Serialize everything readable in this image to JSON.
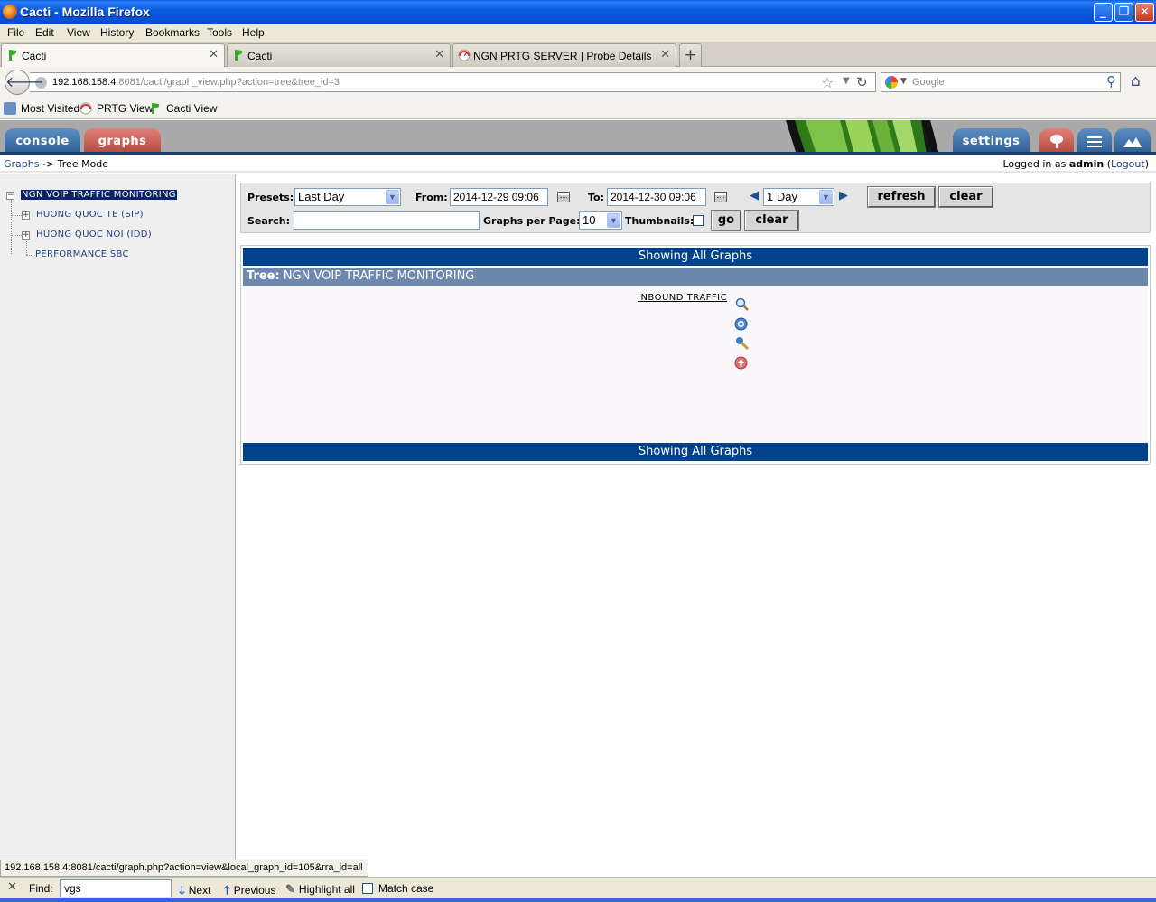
{
  "window": {
    "title": "Cacti - Mozilla Firefox",
    "controls": {
      "minimize": "_",
      "maximize": "❐",
      "close": "✕"
    }
  },
  "menu": [
    "File",
    "Edit",
    "View",
    "History",
    "Bookmarks",
    "Tools",
    "Help"
  ],
  "tabs": [
    {
      "label": "Cacti",
      "active": true
    },
    {
      "label": "Cacti",
      "active": false
    },
    {
      "label": "NGN PRTG SERVER | Probe Details | PRT...",
      "active": false
    }
  ],
  "newtab_label": "+",
  "address": {
    "host": "192.168.158.4",
    "rest": ":8081/cacti/graph_view.php?action=tree&tree_id=3"
  },
  "search": {
    "placeholder": "Google"
  },
  "bookmarks": [
    "Most Visited",
    "PRTG View",
    "Cacti View"
  ],
  "cacti_tabs": {
    "console": "console",
    "graphs": "graphs",
    "settings": "settings"
  },
  "breadcrumb": {
    "graphs": "Graphs",
    "sep": " -> ",
    "mode": "Tree Mode"
  },
  "login": {
    "prefix": "Logged in as ",
    "user": "admin",
    "open": " (",
    "logout": "Logout",
    "close": ")"
  },
  "tree": {
    "root": "NGN VOIP TRAFFIC MONITORING",
    "children": [
      "HUONG QUOC TE (SIP)",
      "HUONG QUOC NOI (IDD)",
      "PERFORMANCE SBC"
    ]
  },
  "filter": {
    "presets_label": "Presets:",
    "presets_value": "Last Day",
    "from_label": "From:",
    "from_value": "2014-12-29 09:06",
    "to_label": "To:",
    "to_value": "2014-12-30 09:06",
    "timespan_value": "1 Day",
    "refresh_label": "refresh",
    "clear_label": "clear",
    "search_label": "Search:",
    "search_value": "",
    "graphs_per_page_label": "Graphs per Page:",
    "graphs_per_page_value": "10",
    "thumbnails_label": "Thumbnails:",
    "go_label": "go",
    "clear2_label": "clear"
  },
  "panel": {
    "header": "Showing All Graphs",
    "tree_prefix": "Tree:",
    "tree_name": "NGN VOIP TRAFFIC MONITORING",
    "graph_title": "INBOUND TRAFFIC",
    "footer": "Showing All Graphs",
    "icons": [
      "zoom-icon",
      "info-icon",
      "properties-icon",
      "export-icon"
    ]
  },
  "statusbar": "192.168.158.4:8081/cacti/graph.php?action=view&local_graph_id=105&rra_id=all",
  "findbar": {
    "close": "✕",
    "label": "Find:",
    "value": "vgs",
    "next": "Next",
    "previous": "Previous",
    "highlight": "Highlight all",
    "match_case": "Match case"
  }
}
